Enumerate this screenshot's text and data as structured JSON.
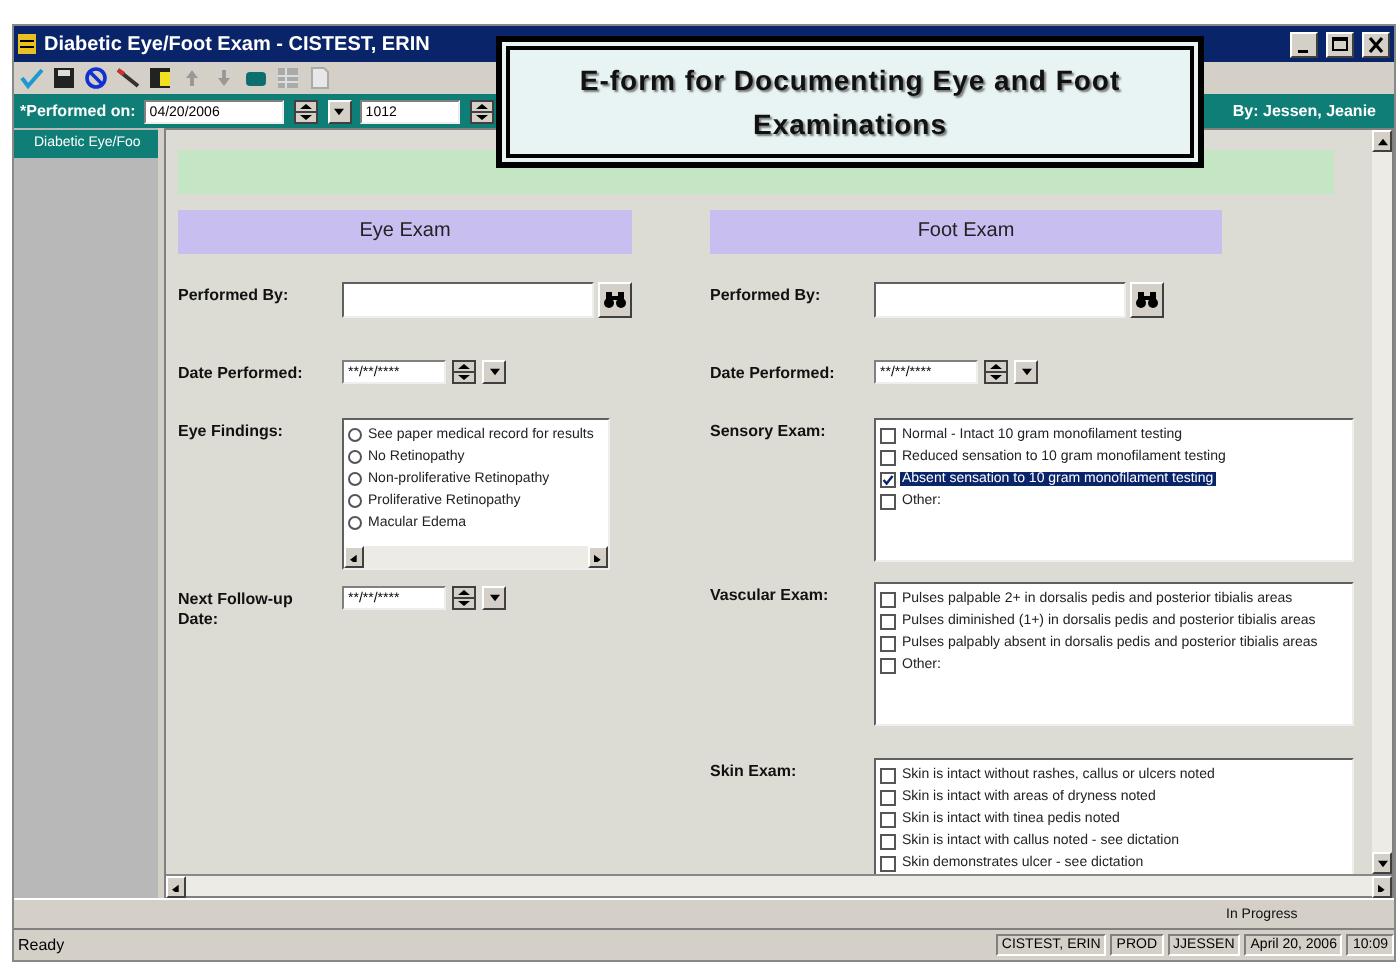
{
  "window": {
    "title": "Diabetic Eye/Foot Exam - CISTEST, ERIN"
  },
  "performed_on": {
    "label": "*Performed on:",
    "date": "04/20/2006",
    "time": "1012"
  },
  "author": "By:  Jessen, Jeanie",
  "sidebar": {
    "items": [
      {
        "label": "Diabetic Eye/Foo",
        "selected": true
      }
    ]
  },
  "callout": "E-form for Documenting Eye and Foot Examinations",
  "eye_exam": {
    "header": "Eye Exam",
    "performed_by": {
      "label": "Performed By:"
    },
    "date_performed": {
      "label": "Date Performed:",
      "value": "**/**/****"
    },
    "findings": {
      "label": "Eye Findings:",
      "options": [
        {
          "label": "See paper medical record for results",
          "selected": false
        },
        {
          "label": "No Retinopathy",
          "selected": false
        },
        {
          "label": "Non-proliferative Retinopathy",
          "selected": false
        },
        {
          "label": "Proliferative Retinopathy",
          "selected": false
        },
        {
          "label": "Macular Edema",
          "selected": false
        }
      ]
    },
    "follow_up": {
      "label": "Next Follow-up Date:",
      "value": "**/**/****"
    }
  },
  "foot_exam": {
    "header": "Foot Exam",
    "performed_by": {
      "label": "Performed By:"
    },
    "date_performed": {
      "label": "Date Performed:",
      "value": "**/**/****"
    },
    "sections": [
      {
        "label": "Sensory Exam:",
        "items": [
          {
            "label": "Normal - Intact 10 gram monofilament testing",
            "checked": false,
            "highlighted": false
          },
          {
            "label": "Reduced sensation to 10 gram monofilament testing",
            "checked": false,
            "highlighted": false
          },
          {
            "label": "Absent sensation to 10 gram monofilament testing",
            "checked": true,
            "highlighted": true
          },
          {
            "label": "Other:",
            "checked": false,
            "highlighted": false
          }
        ]
      },
      {
        "label": "Vascular Exam:",
        "items": [
          {
            "label": "Pulses palpable 2+ in dorsalis pedis and posterior tibialis areas",
            "checked": false,
            "highlighted": false
          },
          {
            "label": "Pulses diminished (1+) in dorsalis pedis and posterior tibialis areas",
            "checked": false,
            "highlighted": false
          },
          {
            "label": "Pulses palpably absent in dorsalis pedis and posterior tibialis areas",
            "checked": false,
            "highlighted": false
          },
          {
            "label": "Other:",
            "checked": false,
            "highlighted": false
          }
        ]
      },
      {
        "label": "Skin Exam:",
        "items": [
          {
            "label": "Skin is intact without rashes, callus or ulcers noted",
            "checked": false,
            "highlighted": false
          },
          {
            "label": "Skin is intact with areas of dryness noted",
            "checked": false,
            "highlighted": false
          },
          {
            "label": "Skin is intact with tinea pedis noted",
            "checked": false,
            "highlighted": false
          },
          {
            "label": "Skin is intact with callus noted - see dictation",
            "checked": false,
            "highlighted": false
          },
          {
            "label": "Skin demonstrates ulcer - see dictation",
            "checked": false,
            "highlighted": false
          }
        ]
      }
    ]
  },
  "form_status": "In Progress",
  "status_bar": {
    "message": "Ready",
    "panes": [
      "CISTEST, ERIN",
      "PROD",
      "JJESSEN",
      "April 20, 2006",
      "10:09"
    ]
  }
}
